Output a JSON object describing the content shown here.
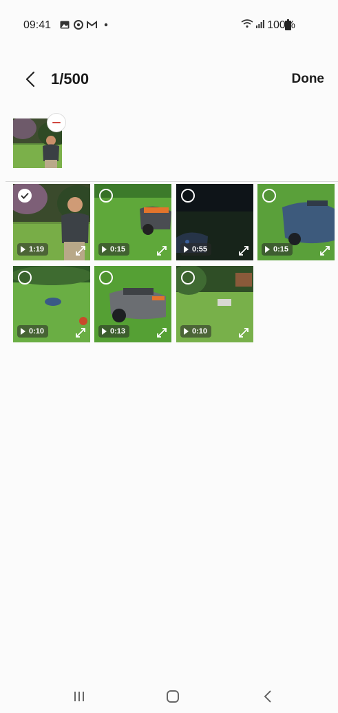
{
  "status_bar": {
    "time": "09:41",
    "battery": "100%"
  },
  "header": {
    "counter": "1/500",
    "done_label": "Done"
  },
  "colors": {
    "accent_remove": "#d0463f",
    "background": "#fbfbfb"
  },
  "grid": {
    "items": [
      {
        "duration": "1:19",
        "selected": true
      },
      {
        "duration": "0:15",
        "selected": false
      },
      {
        "duration": "0:55",
        "selected": false
      },
      {
        "duration": "0:15",
        "selected": false
      },
      {
        "duration": "0:10",
        "selected": false
      },
      {
        "duration": "0:13",
        "selected": false
      },
      {
        "duration": "0:10",
        "selected": false
      }
    ]
  },
  "icons": {
    "back": "chevron-left-icon",
    "remove": "minus-icon",
    "check": "check-icon",
    "play": "play-icon",
    "expand": "expand-icon",
    "recents": "recents-icon",
    "home": "home-icon",
    "nav_back": "back-icon"
  }
}
